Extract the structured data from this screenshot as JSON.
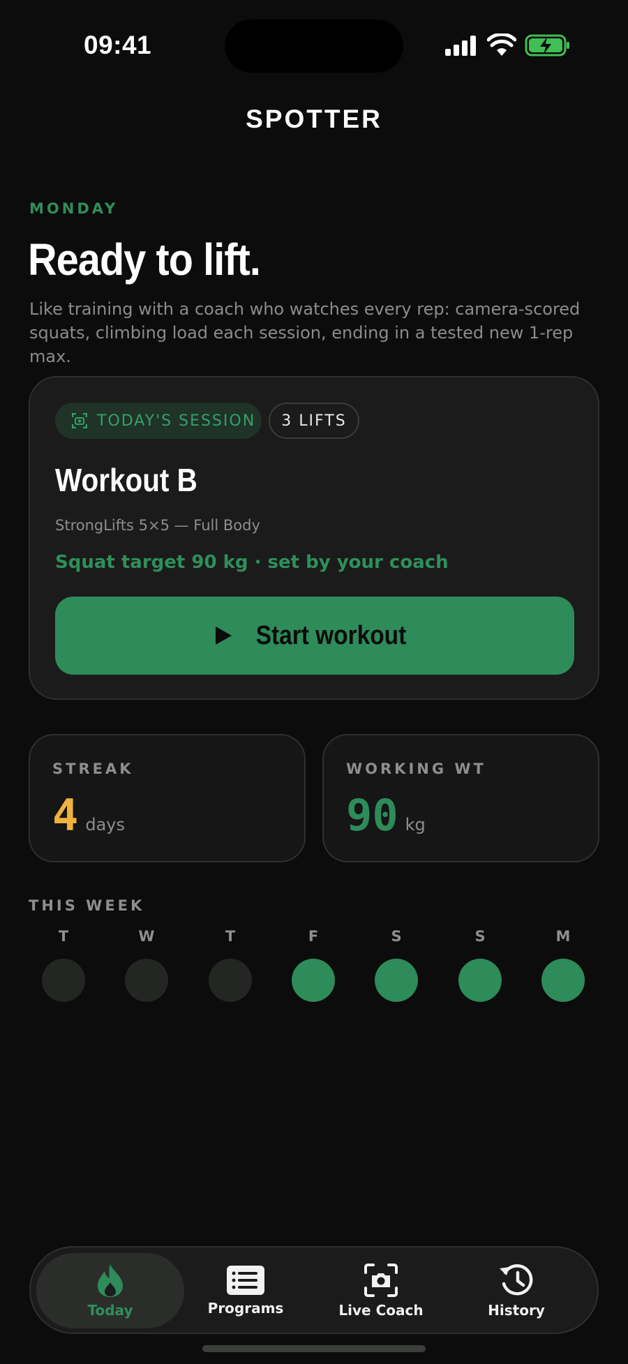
{
  "status_bar": {
    "time": "09:41"
  },
  "app": {
    "title": "SPOTTER"
  },
  "hero": {
    "day": "MONDAY",
    "headline": "Ready to lift.",
    "intro": "Like training with a coach who watches every rep: camera-scored squats, climbing load each session, ending in a tested new 1-rep max."
  },
  "session_card": {
    "session_chip": "TODAY'S SESSION",
    "lifts_chip": "3 LIFTS",
    "title": "Workout B",
    "subtitle": "StrongLifts 5×5 — Full Body",
    "target": "Squat target 90 kg · set by your coach",
    "start_label": "Start workout"
  },
  "stats": {
    "streak": {
      "label": "STREAK",
      "value": "4",
      "unit": "days"
    },
    "working_wt": {
      "label": "WORKING WT",
      "value": "90",
      "unit": "kg"
    }
  },
  "week": {
    "label": "THIS WEEK",
    "days": [
      {
        "letter": "T",
        "done": false
      },
      {
        "letter": "W",
        "done": false
      },
      {
        "letter": "T",
        "done": false
      },
      {
        "letter": "F",
        "done": true
      },
      {
        "letter": "S",
        "done": true
      },
      {
        "letter": "S",
        "done": true
      },
      {
        "letter": "M",
        "done": true
      }
    ]
  },
  "tabs": [
    {
      "label": "Today",
      "icon": "flame-icon",
      "active": true
    },
    {
      "label": "Programs",
      "icon": "list-icon",
      "active": false
    },
    {
      "label": "Live Coach",
      "icon": "camera-icon",
      "active": false
    },
    {
      "label": "History",
      "icon": "history-icon",
      "active": false
    }
  ],
  "colors": {
    "accent": "#2e8b5a",
    "streak": "#f0b23c",
    "background": "#0b0c0b",
    "inactive_dot": "#242624"
  }
}
